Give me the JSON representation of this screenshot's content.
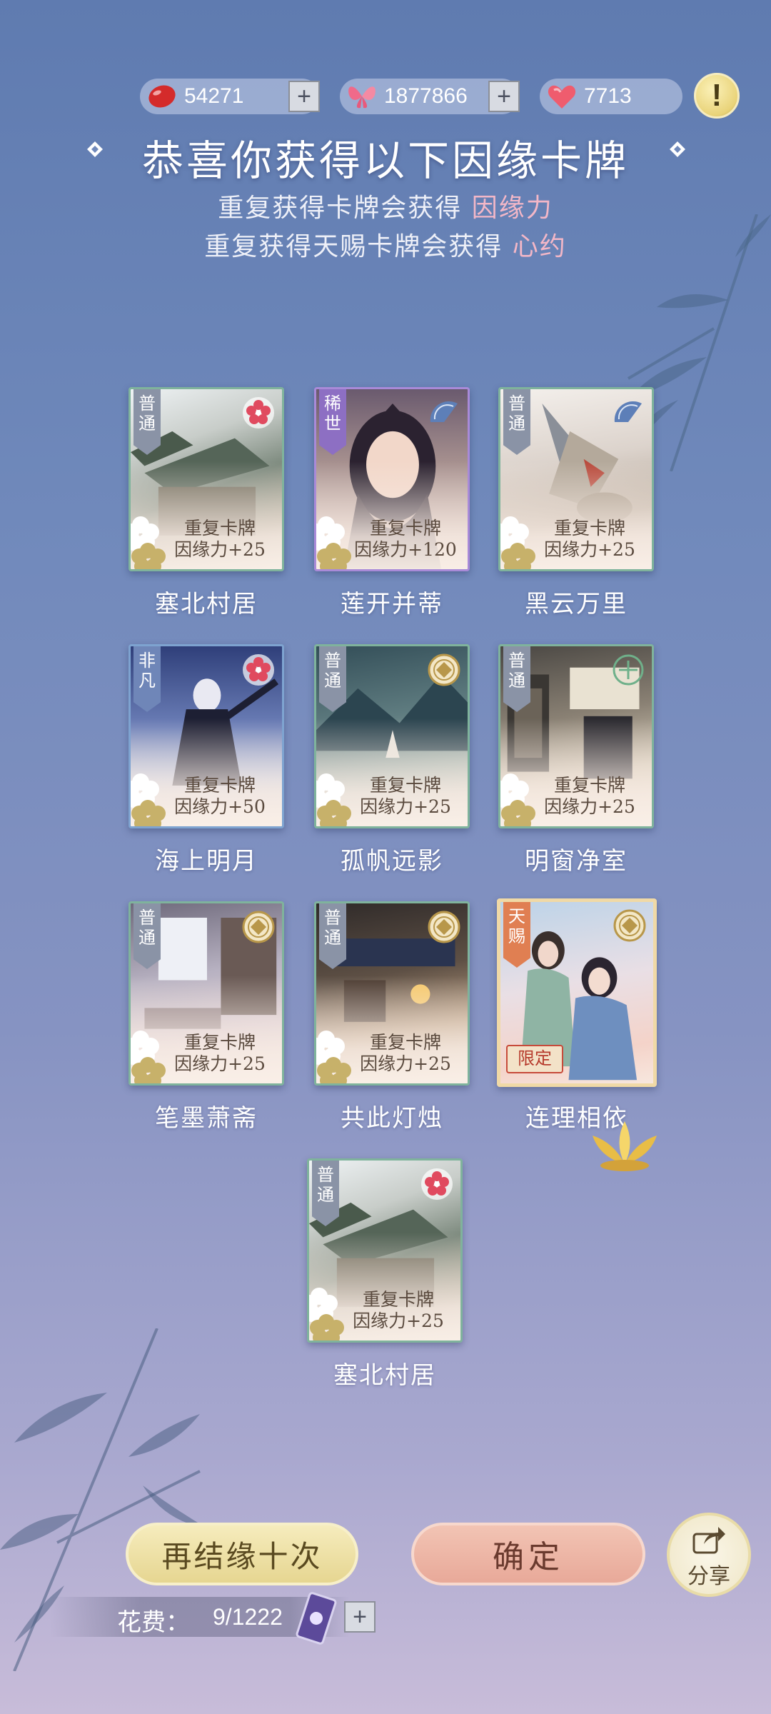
{
  "currencies": [
    {
      "icon": "red-bean-icon",
      "value": "54271"
    },
    {
      "icon": "butterfly-icon",
      "value": "1877866"
    },
    {
      "icon": "heart-icon",
      "value": "7713"
    }
  ],
  "info_label": "!",
  "title": "恭喜你获得以下因缘卡牌",
  "subtitle1": {
    "text": "重复获得卡牌会获得",
    "highlight": "因缘力"
  },
  "subtitle2": {
    "text": "重复获得天赐卡牌会获得",
    "highlight": "心约"
  },
  "cards": [
    {
      "rarity": "普通",
      "name": "塞北村居",
      "dup_title": "重复卡牌",
      "dup_reward": "因缘力+25",
      "emblem": "plum-blossom-icon"
    },
    {
      "rarity": "稀世",
      "name": "莲开并蒂",
      "dup_title": "重复卡牌",
      "dup_reward": "因缘力+120",
      "emblem": "fan-icon"
    },
    {
      "rarity": "普通",
      "name": "黑云万里",
      "dup_title": "重复卡牌",
      "dup_reward": "因缘力+25",
      "emblem": "fan-icon"
    },
    {
      "rarity": "非凡",
      "name": "海上明月",
      "dup_title": "重复卡牌",
      "dup_reward": "因缘力+50",
      "emblem": "plum-blossom-icon"
    },
    {
      "rarity": "普通",
      "name": "孤帆远影",
      "dup_title": "重复卡牌",
      "dup_reward": "因缘力+25",
      "emblem": "coin-emblem-icon"
    },
    {
      "rarity": "普通",
      "name": "明窗净室",
      "dup_title": "重复卡牌",
      "dup_reward": "因缘力+25",
      "emblem": "jade-emblem-icon"
    },
    {
      "rarity": "普通",
      "name": "笔墨萧斋",
      "dup_title": "重复卡牌",
      "dup_reward": "因缘力+25",
      "emblem": "coin-emblem-icon"
    },
    {
      "rarity": "普通",
      "name": "共此灯烛",
      "dup_title": "重复卡牌",
      "dup_reward": "因缘力+25",
      "emblem": "coin-emblem-icon"
    },
    {
      "rarity": "天赐",
      "name": "连理相依",
      "limited": "限定",
      "emblem": "coin-emblem-icon"
    },
    {
      "rarity": "普通",
      "name": "塞北村居",
      "dup_title": "重复卡牌",
      "dup_reward": "因缘力+25",
      "emblem": "plum-blossom-icon"
    }
  ],
  "buttons": {
    "retry": "再结缘十次",
    "confirm": "确定",
    "share": "分享"
  },
  "cost": {
    "label": "花费：",
    "value": "9/1222"
  },
  "colors": {
    "highlight_pink": "#f3b7c7",
    "gold_button": "#e9d991",
    "pink_button": "#eab1a1"
  }
}
